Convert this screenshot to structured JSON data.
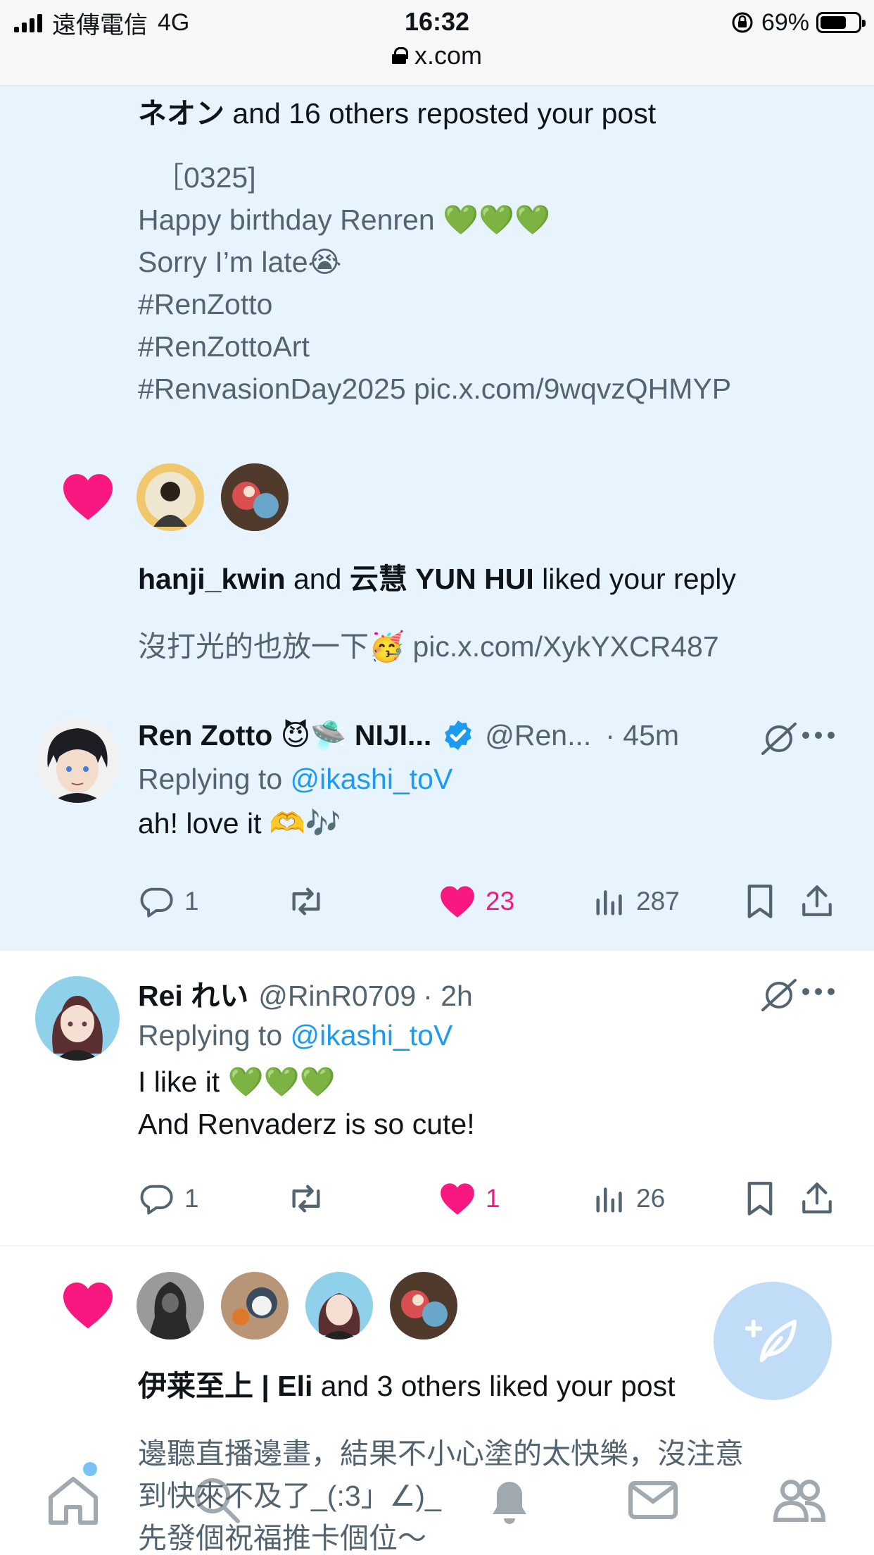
{
  "status_bar": {
    "carrier": "遠傳電信",
    "network": "4G",
    "time": "16:32",
    "url": "x.com",
    "battery": "69%",
    "battery_level": 0.69
  },
  "notifications": [
    {
      "type": "repost",
      "actor": "ネオン",
      "rest": " and 16 others reposted your post",
      "post_lines": [
        "［0325]",
        "Happy birthday Renren 💚💚💚",
        "Sorry I’m late😭",
        "#RenZotto",
        "#RenZottoArt",
        "#RenvasionDay2025 pic.x.com/9wqvzQHMYP"
      ]
    },
    {
      "type": "like",
      "actor1": "hanji_kwin",
      "joiner": " and ",
      "actor2": "云慧 YUN HUI",
      "rest": " liked your reply",
      "post_text": "沒打光的也放一下🥳 pic.x.com/XykYXCR487"
    },
    {
      "type": "reply",
      "name": "Ren Zotto 😈🛸 NIJI...",
      "handle": "@Ren...",
      "time": "· 45m",
      "replying_prefix": "Replying to ",
      "replying_to": "@ikashi_toV",
      "text_lines": [
        "ah! love it 🫶🎶"
      ],
      "replies": "1",
      "likes": "23",
      "views": "287"
    },
    {
      "type": "reply",
      "name": "Rei れい",
      "handle": "@RinR0709",
      "time": "· 2h",
      "replying_prefix": "Replying to ",
      "replying_to": "@ikashi_toV",
      "text_lines": [
        "I like it 💚💚💚",
        "And Renvaderz is so cute!"
      ],
      "replies": "1",
      "likes": "1",
      "views": "26"
    },
    {
      "type": "like",
      "actor1": "伊莱至上 | Eli",
      "rest": " and 3 others liked your post",
      "post_lines": [
        "邊聽直播邊畫，結果不小心塗的太快樂，沒注意",
        "到快來不及了_(:3」∠)_",
        "先發個祝福推卡個位～"
      ]
    }
  ],
  "icons": {
    "like": "heart-icon",
    "reply": "reply-icon",
    "repost": "repost-icon",
    "views": "views-icon",
    "bookmark": "bookmark-icon",
    "share": "share-icon",
    "grok": "grok-icon",
    "more": "more-icon",
    "compose": "compose-icon"
  },
  "colors": {
    "highlight_bg": "#e8f4fd",
    "like_pink": "#f91880",
    "link_blue": "#1d9bf0",
    "fab_bg": "#c0dcf6"
  }
}
